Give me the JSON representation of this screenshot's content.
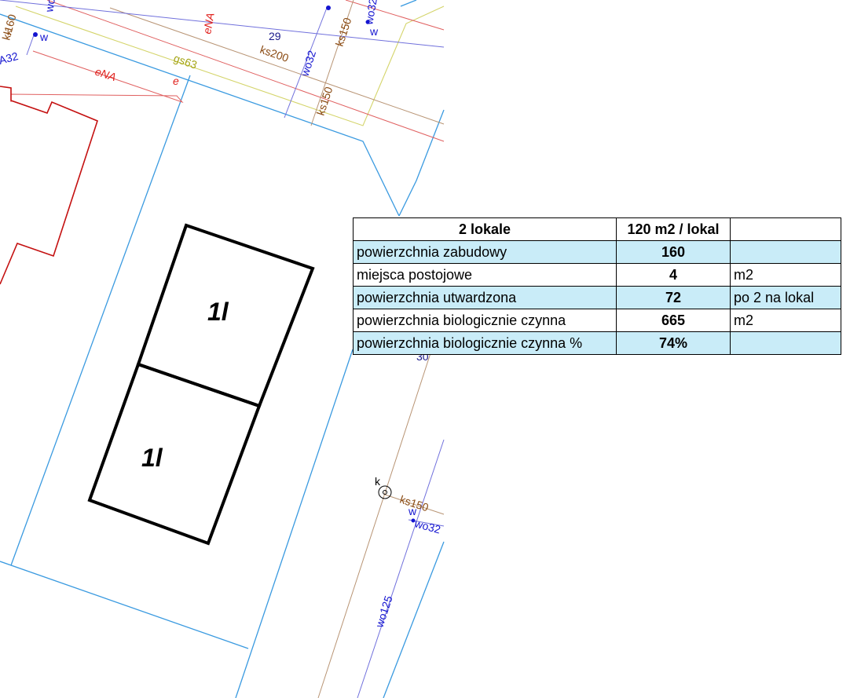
{
  "map": {
    "labels": {
      "ena_top": "eNA",
      "ena_left": "eNA",
      "e_small": "e",
      "gs63": "gs63",
      "ks200": "ks200",
      "num29": "29",
      "num30": "30",
      "wo32_a": "wo32",
      "ks150_a": "ks150",
      "ks150_b": "ks150",
      "wo32_b": "wo32",
      "wo_top": "wo",
      "kl160": "kl160",
      "k_left": "k",
      "a32": "A32",
      "w_left": "w",
      "w_top": "w",
      "w_right": "w",
      "k_right": "k",
      "ks150_c": "ks150",
      "wo32_c": "wo32",
      "wo125": "wo125"
    },
    "buildings": [
      "1l",
      "1l"
    ],
    "colors": {
      "parcel_line": "#3a9ae0",
      "sewer_line": "#b08860",
      "water_line": "#6a6ad8",
      "gas_line": "#d8d860",
      "power_line": "#e05050",
      "boundary": "#c41010",
      "building": "#000000",
      "band": "#c9ecf8"
    }
  },
  "table": {
    "header": {
      "c1": "2 lokale",
      "c2": "120 m2 / lokal",
      "c3": ""
    },
    "rows": [
      {
        "c1": "powierzchnia zabudowy",
        "c2": "160",
        "c3": ""
      },
      {
        "c1": "miejsca postojowe",
        "c2": "4",
        "c3": "m2"
      },
      {
        "c1": "powierzchnia utwardzona",
        "c2": "72",
        "c3": "po 2 na lokal"
      },
      {
        "c1": "powierzchnia biologicznie czynna",
        "c2": "665",
        "c3": "m2"
      },
      {
        "c1": "powierzchnia biologicznie czynna %",
        "c2": "74%",
        "c3": ""
      }
    ]
  }
}
